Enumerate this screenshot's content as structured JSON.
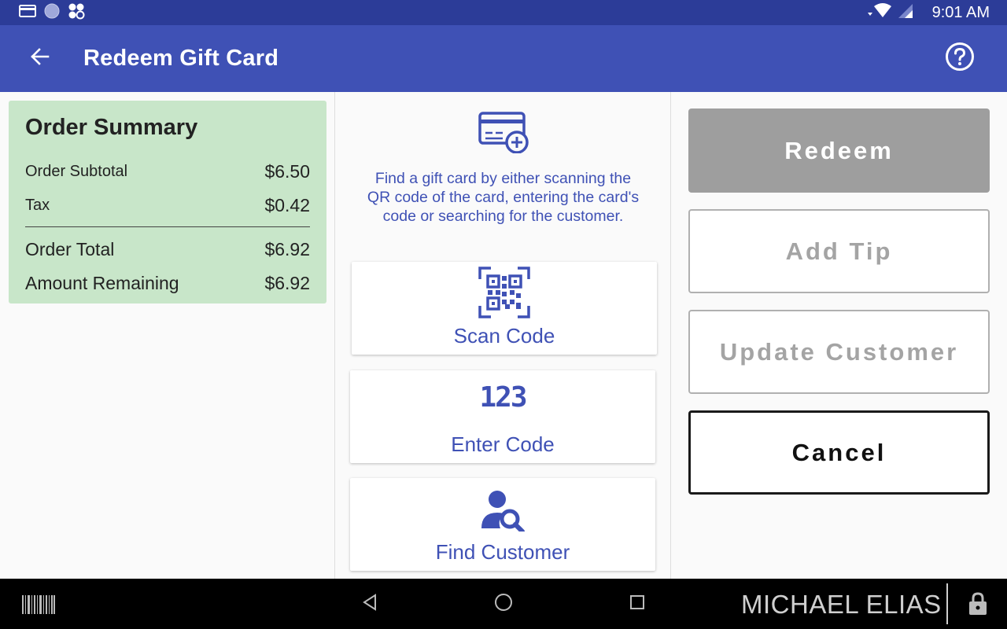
{
  "status_bar": {
    "time": "9:01 AM",
    "icons": [
      "card-reader-icon",
      "circle-icon",
      "clover-icon",
      "wifi-icon",
      "cell-signal-icon"
    ]
  },
  "app_bar": {
    "title": "Redeem Gift Card",
    "back_icon": "arrow-back-icon",
    "help_icon": "help-circle-icon",
    "color": "#3f51b5"
  },
  "order_summary": {
    "title": "Order Summary",
    "rows": [
      {
        "label": "Order Subtotal",
        "value": "$6.50"
      },
      {
        "label": "Tax",
        "value": "$0.42"
      },
      {
        "label": "Order Total",
        "value": "$6.92"
      },
      {
        "label": "Amount Remaining",
        "value": "$6.92"
      }
    ],
    "background": "#c8e6c9"
  },
  "lookup": {
    "instructions": "Find a gift card by either scanning the QR code of the card, entering the card's code or searching for the customer.",
    "options": [
      {
        "label": "Scan Code",
        "icon": "qr-code-icon"
      },
      {
        "label": "Enter Code",
        "icon": "numbers-icon",
        "icon_text": "123"
      },
      {
        "label": "Find Customer",
        "icon": "person-search-icon"
      }
    ]
  },
  "actions": {
    "redeem": "Redeem",
    "add_tip": "Add Tip",
    "update_customer": "Update Customer",
    "cancel": "Cancel"
  },
  "nav_bar": {
    "user_name": "MICHAEL ELIAS",
    "icons": [
      "barcode-icon",
      "back-triangle-icon",
      "home-circle-icon",
      "recents-square-icon",
      "lock-icon"
    ]
  }
}
